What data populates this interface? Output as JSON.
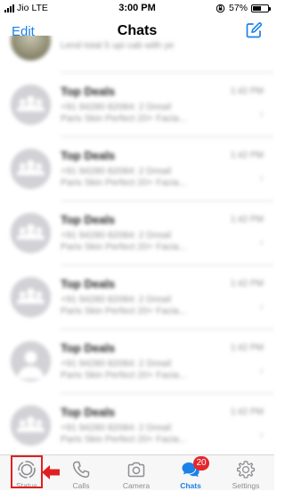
{
  "status_bar": {
    "carrier": "Jio",
    "network": "LTE",
    "time": "3:00 PM",
    "battery": "57%",
    "battery_level": 0.57
  },
  "nav": {
    "edit_label": "Edit",
    "title": "Chats",
    "compose_icon": "compose-icon"
  },
  "top_partial_chat": {
    "preview": "Lend total 5 upi cab with ye"
  },
  "chats": [
    {
      "name": "Top Deals",
      "time": "1:42 PM",
      "line1": "+91 94280 82084: 2 Dreail",
      "line2": "Paris Skin Perfect 20+ Facia...",
      "avatar": "group-avatar-icon"
    },
    {
      "name": "Top Deals",
      "time": "1:42 PM",
      "line1": "+91 94280 82084: 2 Dreail",
      "line2": "Paris Skin Perfect 20+ Facia...",
      "avatar": "group-avatar-icon"
    },
    {
      "name": "Top Deals",
      "time": "1:42 PM",
      "line1": "+91 94280 82084: 2 Dreail",
      "line2": "Paris Skin Perfect 20+ Facia...",
      "avatar": "group-avatar-icon"
    },
    {
      "name": "Top Deals",
      "time": "1:42 PM",
      "line1": "+91 94280 82084: 2 Dreail",
      "line2": "Paris Skin Perfect 20+ Facia...",
      "avatar": "group-avatar-icon"
    },
    {
      "name": "Top Deals",
      "time": "1:42 PM",
      "line1": "+91 94280 82084: 2 Dreail",
      "line2": "Paris Skin Perfect 20+ Facia...",
      "avatar": "person-avatar-icon"
    },
    {
      "name": "Top Deals",
      "time": "1:42 PM",
      "line1": "+91 94280 82084: 2 Dreail",
      "line2": "Paris Skin Perfect 20+ Facia...",
      "avatar": "group-avatar-icon"
    }
  ],
  "tabs": [
    {
      "label": "Status",
      "icon": "status-icon"
    },
    {
      "label": "Calls",
      "icon": "phone-icon"
    },
    {
      "label": "Camera",
      "icon": "camera-icon"
    },
    {
      "label": "Chats",
      "icon": "chats-icon",
      "badge": "20",
      "active": true
    },
    {
      "label": "Settings",
      "icon": "gear-icon"
    }
  ],
  "colors": {
    "accent": "#1a82e8",
    "badge": "#e4282c",
    "highlight": "#e02020"
  }
}
